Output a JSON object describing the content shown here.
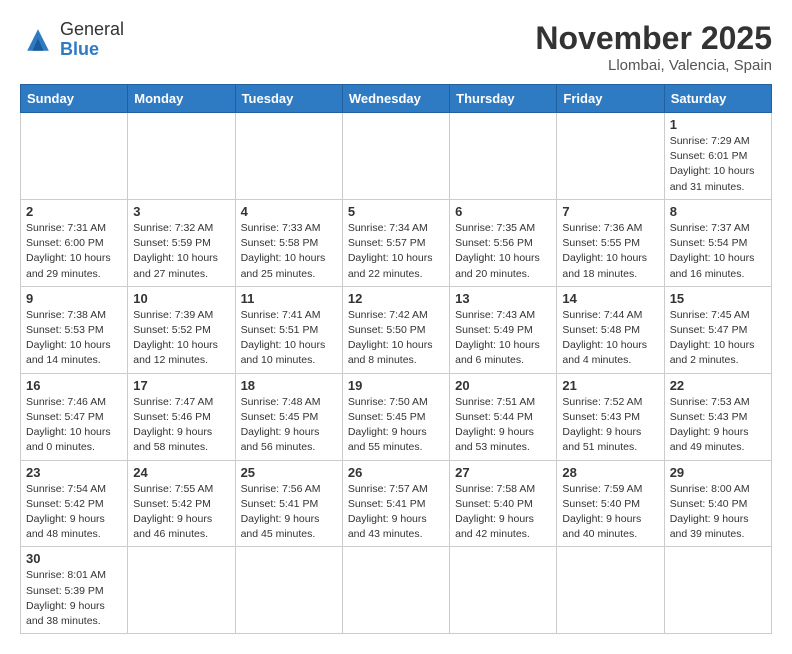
{
  "header": {
    "logo_general": "General",
    "logo_blue": "Blue",
    "month_title": "November 2025",
    "location": "Llombai, Valencia, Spain"
  },
  "weekdays": [
    "Sunday",
    "Monday",
    "Tuesday",
    "Wednesday",
    "Thursday",
    "Friday",
    "Saturday"
  ],
  "weeks": [
    [
      {
        "day": "",
        "info": ""
      },
      {
        "day": "",
        "info": ""
      },
      {
        "day": "",
        "info": ""
      },
      {
        "day": "",
        "info": ""
      },
      {
        "day": "",
        "info": ""
      },
      {
        "day": "",
        "info": ""
      },
      {
        "day": "1",
        "info": "Sunrise: 7:29 AM\nSunset: 6:01 PM\nDaylight: 10 hours and 31 minutes."
      }
    ],
    [
      {
        "day": "2",
        "info": "Sunrise: 7:31 AM\nSunset: 6:00 PM\nDaylight: 10 hours and 29 minutes."
      },
      {
        "day": "3",
        "info": "Sunrise: 7:32 AM\nSunset: 5:59 PM\nDaylight: 10 hours and 27 minutes."
      },
      {
        "day": "4",
        "info": "Sunrise: 7:33 AM\nSunset: 5:58 PM\nDaylight: 10 hours and 25 minutes."
      },
      {
        "day": "5",
        "info": "Sunrise: 7:34 AM\nSunset: 5:57 PM\nDaylight: 10 hours and 22 minutes."
      },
      {
        "day": "6",
        "info": "Sunrise: 7:35 AM\nSunset: 5:56 PM\nDaylight: 10 hours and 20 minutes."
      },
      {
        "day": "7",
        "info": "Sunrise: 7:36 AM\nSunset: 5:55 PM\nDaylight: 10 hours and 18 minutes."
      },
      {
        "day": "8",
        "info": "Sunrise: 7:37 AM\nSunset: 5:54 PM\nDaylight: 10 hours and 16 minutes."
      }
    ],
    [
      {
        "day": "9",
        "info": "Sunrise: 7:38 AM\nSunset: 5:53 PM\nDaylight: 10 hours and 14 minutes."
      },
      {
        "day": "10",
        "info": "Sunrise: 7:39 AM\nSunset: 5:52 PM\nDaylight: 10 hours and 12 minutes."
      },
      {
        "day": "11",
        "info": "Sunrise: 7:41 AM\nSunset: 5:51 PM\nDaylight: 10 hours and 10 minutes."
      },
      {
        "day": "12",
        "info": "Sunrise: 7:42 AM\nSunset: 5:50 PM\nDaylight: 10 hours and 8 minutes."
      },
      {
        "day": "13",
        "info": "Sunrise: 7:43 AM\nSunset: 5:49 PM\nDaylight: 10 hours and 6 minutes."
      },
      {
        "day": "14",
        "info": "Sunrise: 7:44 AM\nSunset: 5:48 PM\nDaylight: 10 hours and 4 minutes."
      },
      {
        "day": "15",
        "info": "Sunrise: 7:45 AM\nSunset: 5:47 PM\nDaylight: 10 hours and 2 minutes."
      }
    ],
    [
      {
        "day": "16",
        "info": "Sunrise: 7:46 AM\nSunset: 5:47 PM\nDaylight: 10 hours and 0 minutes."
      },
      {
        "day": "17",
        "info": "Sunrise: 7:47 AM\nSunset: 5:46 PM\nDaylight: 9 hours and 58 minutes."
      },
      {
        "day": "18",
        "info": "Sunrise: 7:48 AM\nSunset: 5:45 PM\nDaylight: 9 hours and 56 minutes."
      },
      {
        "day": "19",
        "info": "Sunrise: 7:50 AM\nSunset: 5:45 PM\nDaylight: 9 hours and 55 minutes."
      },
      {
        "day": "20",
        "info": "Sunrise: 7:51 AM\nSunset: 5:44 PM\nDaylight: 9 hours and 53 minutes."
      },
      {
        "day": "21",
        "info": "Sunrise: 7:52 AM\nSunset: 5:43 PM\nDaylight: 9 hours and 51 minutes."
      },
      {
        "day": "22",
        "info": "Sunrise: 7:53 AM\nSunset: 5:43 PM\nDaylight: 9 hours and 49 minutes."
      }
    ],
    [
      {
        "day": "23",
        "info": "Sunrise: 7:54 AM\nSunset: 5:42 PM\nDaylight: 9 hours and 48 minutes."
      },
      {
        "day": "24",
        "info": "Sunrise: 7:55 AM\nSunset: 5:42 PM\nDaylight: 9 hours and 46 minutes."
      },
      {
        "day": "25",
        "info": "Sunrise: 7:56 AM\nSunset: 5:41 PM\nDaylight: 9 hours and 45 minutes."
      },
      {
        "day": "26",
        "info": "Sunrise: 7:57 AM\nSunset: 5:41 PM\nDaylight: 9 hours and 43 minutes."
      },
      {
        "day": "27",
        "info": "Sunrise: 7:58 AM\nSunset: 5:40 PM\nDaylight: 9 hours and 42 minutes."
      },
      {
        "day": "28",
        "info": "Sunrise: 7:59 AM\nSunset: 5:40 PM\nDaylight: 9 hours and 40 minutes."
      },
      {
        "day": "29",
        "info": "Sunrise: 8:00 AM\nSunset: 5:40 PM\nDaylight: 9 hours and 39 minutes."
      }
    ],
    [
      {
        "day": "30",
        "info": "Sunrise: 8:01 AM\nSunset: 5:39 PM\nDaylight: 9 hours and 38 minutes."
      },
      {
        "day": "",
        "info": ""
      },
      {
        "day": "",
        "info": ""
      },
      {
        "day": "",
        "info": ""
      },
      {
        "day": "",
        "info": ""
      },
      {
        "day": "",
        "info": ""
      },
      {
        "day": "",
        "info": ""
      }
    ]
  ]
}
